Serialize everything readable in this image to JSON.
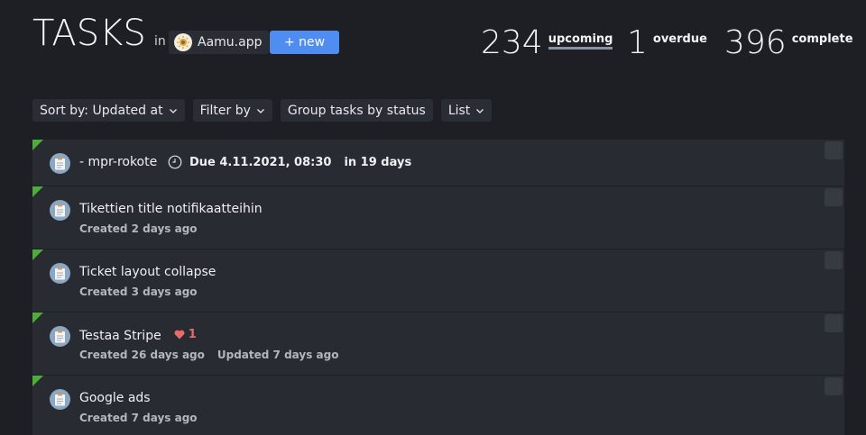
{
  "header": {
    "title": "TASKS",
    "in_label": "in",
    "org_name": "Aamu.app",
    "new_button": "+ new"
  },
  "stats": {
    "upcoming": {
      "count": "234",
      "label": "upcoming"
    },
    "overdue": {
      "count": "1",
      "label": "overdue"
    },
    "complete": {
      "count": "396",
      "label": "complete"
    }
  },
  "toolbar": {
    "sort": "Sort by: Updated at",
    "filter": "Filter by",
    "group": "Group tasks by status",
    "view": "List"
  },
  "tasks": [
    {
      "title": "- mpr-rokote",
      "due": "Due 4.11.2021, 08:30",
      "due_relative": "in 19 days"
    },
    {
      "title": "Tikettien title notifikaatteihin",
      "created": "Created 2 days ago"
    },
    {
      "title": "Ticket layout collapse",
      "created": "Created 3 days ago"
    },
    {
      "title": "Testaa Stripe",
      "likes": "1",
      "created": "Created 26 days ago",
      "updated": "Updated 7 days ago"
    },
    {
      "title": "Google ads",
      "created": "Created 7 days ago"
    }
  ],
  "colors": {
    "background": "#1d1f24",
    "card": "#282b31",
    "accent": "#4f8ef0",
    "status_corner": "#4cae38",
    "like": "#e76b6b"
  }
}
